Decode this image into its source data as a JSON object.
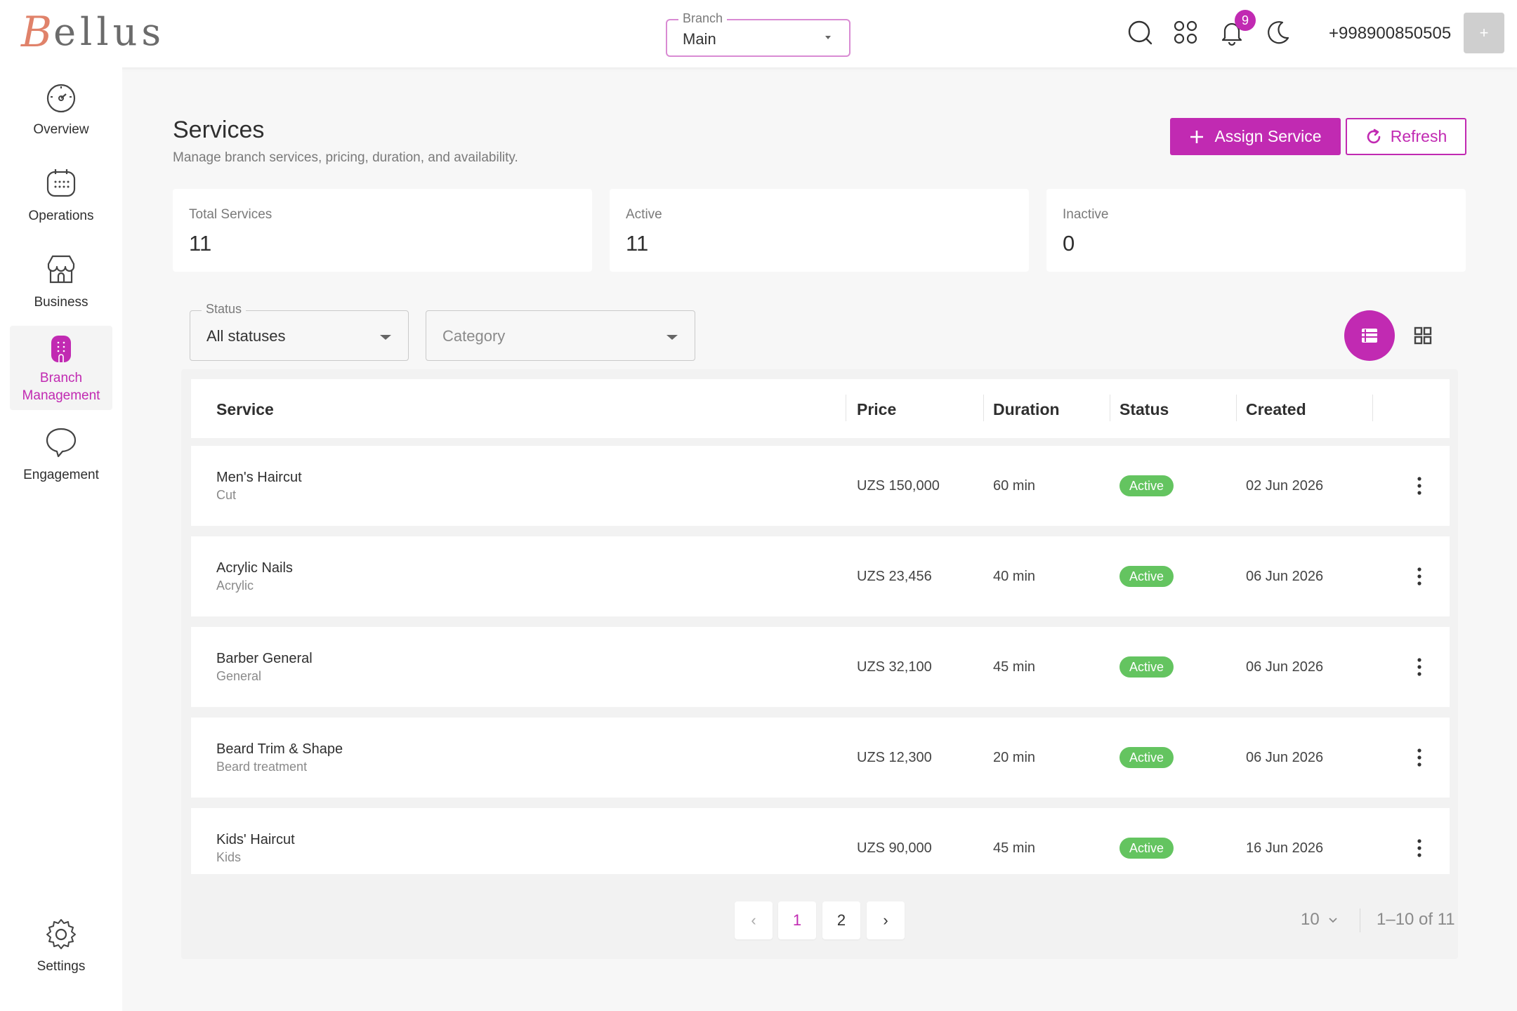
{
  "app": {
    "logo_initial": "B",
    "logo_rest": "ellus"
  },
  "header": {
    "branch": {
      "legend": "Branch",
      "value": "Main"
    },
    "notifications_count": "9",
    "phone": "+998900850505",
    "avatar": "+"
  },
  "sidebar": {
    "items": [
      {
        "label": "Overview",
        "icon": "speedometer-icon"
      },
      {
        "label": "Operations",
        "icon": "calendar-icon"
      },
      {
        "label": "Business",
        "icon": "storefront-icon"
      },
      {
        "label_1": "Branch",
        "label_2": "Management",
        "icon": "branch-icon",
        "active": true
      },
      {
        "label": "Engagement",
        "icon": "chat-bubble-icon"
      }
    ],
    "settings": "Settings"
  },
  "page": {
    "title": "Services",
    "subtitle": "Manage branch services, pricing, duration, and availability.",
    "assign_label": "Assign Service",
    "refresh_label": "Refresh"
  },
  "stats": [
    {
      "label": "Total Services",
      "value": "11"
    },
    {
      "label": "Active",
      "value": "11"
    },
    {
      "label": "Inactive",
      "value": "0"
    }
  ],
  "filters": {
    "status": {
      "legend": "Status",
      "value": "All statuses"
    },
    "category": {
      "placeholder": "Category"
    }
  },
  "table": {
    "columns": [
      "Service",
      "Price",
      "Duration",
      "Status",
      "Created"
    ],
    "rows": [
      {
        "name": "Men's Haircut",
        "category": "Cut",
        "price": "UZS 150,000",
        "duration": "60 min",
        "status": "Active",
        "created": "02 Jun 2026"
      },
      {
        "name": "Acrylic Nails",
        "category": "Acrylic",
        "price": "UZS 23,456",
        "duration": "40 min",
        "status": "Active",
        "created": "06 Jun 2026"
      },
      {
        "name": "Barber General",
        "category": "General",
        "price": "UZS 32,100",
        "duration": "45 min",
        "status": "Active",
        "created": "06 Jun 2026"
      },
      {
        "name": "Beard Trim & Shape",
        "category": "Beard treatment",
        "price": "UZS 12,300",
        "duration": "20 min",
        "status": "Active",
        "created": "06 Jun 2026"
      },
      {
        "name": "Kids' Haircut",
        "category": "Kids",
        "price": "UZS 90,000",
        "duration": "45 min",
        "status": "Active",
        "created": "16 Jun 2026"
      }
    ]
  },
  "pagination": {
    "prev": "‹",
    "pages": [
      "1",
      "2"
    ],
    "next": "›",
    "per_page": "10",
    "range": "1–10 of 11"
  },
  "colors": {
    "accent": "#c12ab2",
    "active_badge": "#64c460",
    "logo": "#e0826a"
  }
}
